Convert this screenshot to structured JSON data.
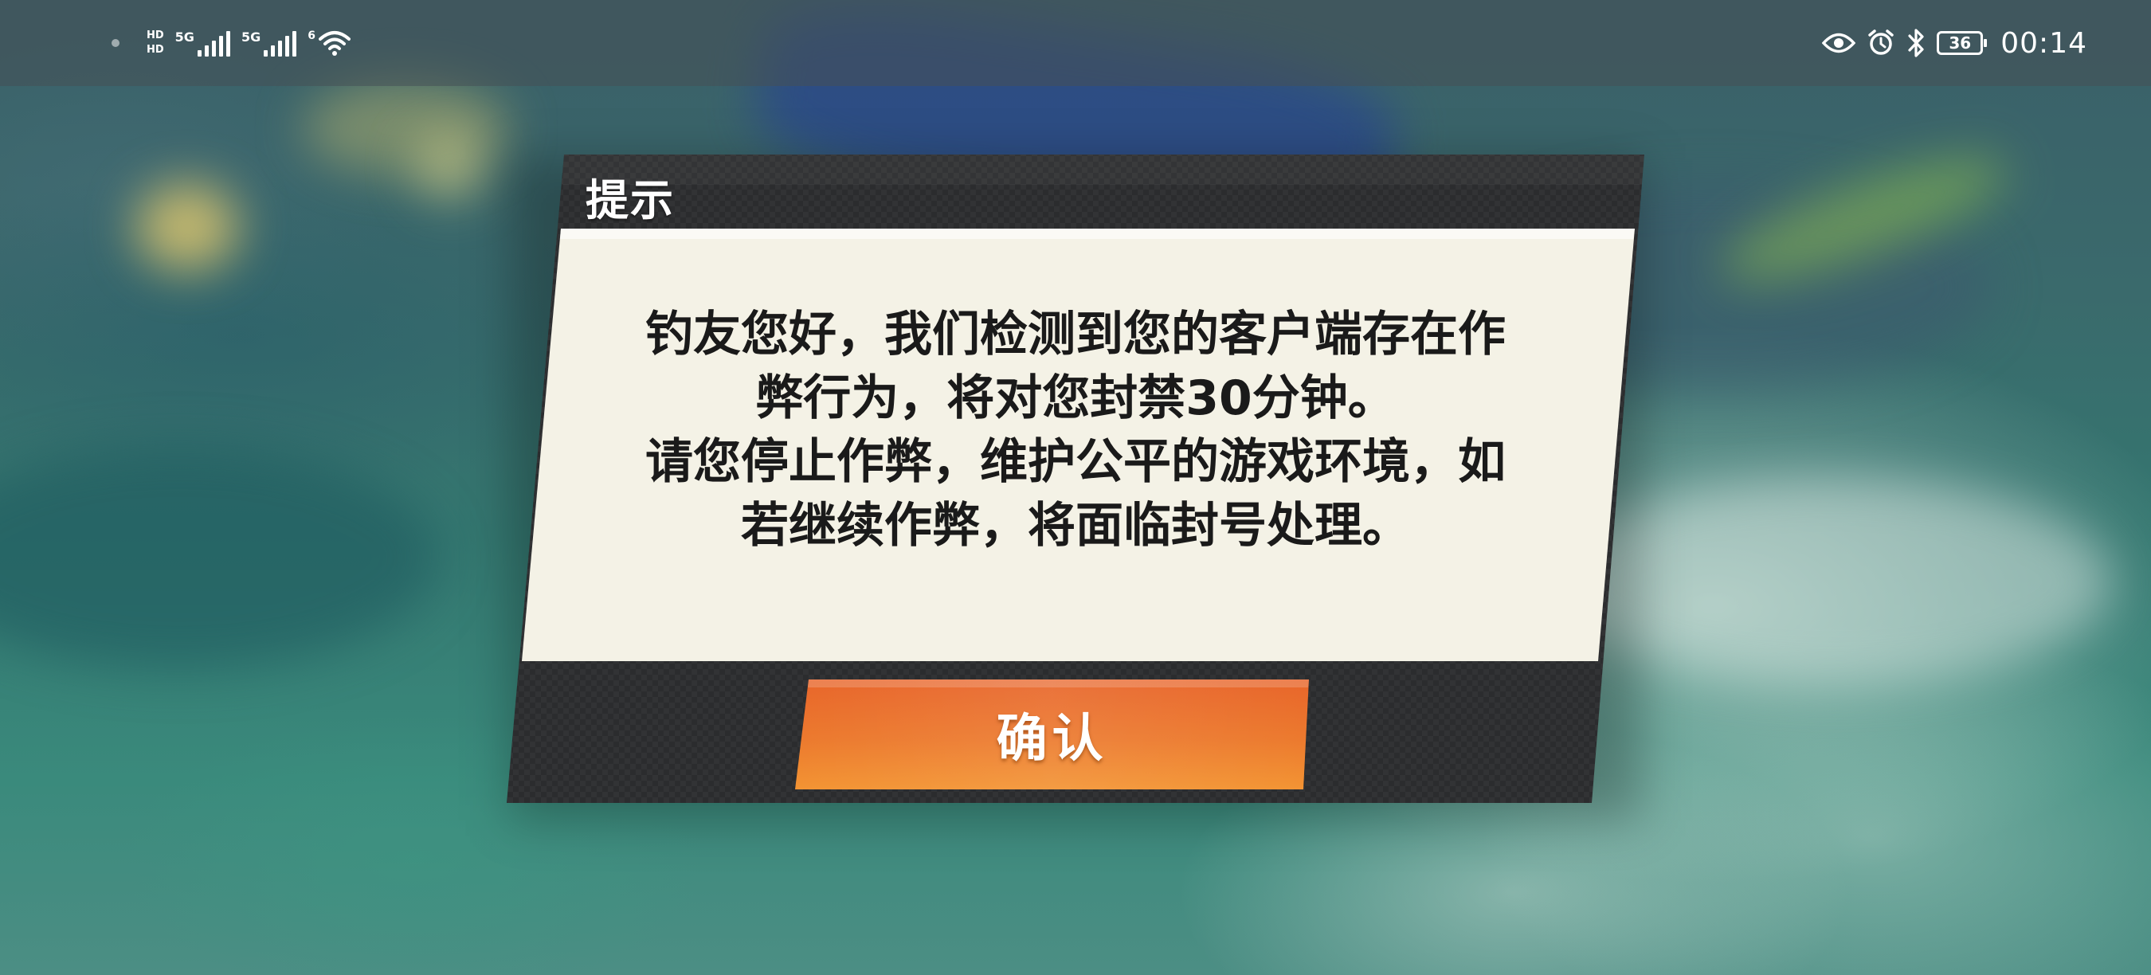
{
  "status_bar": {
    "left": {
      "hd_top": "HD",
      "hd_bottom": "HD",
      "sim1_network": "5G",
      "sim2_network": "5G",
      "wifi_label": "6"
    },
    "right": {
      "icons": [
        "eye-icon",
        "alarm-icon",
        "bluetooth-icon",
        "battery-icon"
      ],
      "battery_level": "36",
      "time": "00:14"
    }
  },
  "dialog": {
    "title": "提示",
    "message_lines": [
      "钓友您好，我们检测到您的客户端存在作",
      "弊行为，将对您封禁30分钟。",
      "请您停止作弊，维护公平的游戏环境，如",
      "若继续作弊，将面临封号处理。"
    ],
    "confirm_label": "确认"
  },
  "colors": {
    "dialog_frame": "#2a2b2d",
    "content_panel": "#f4f2e6",
    "button_orange_top": "#ea6a2a",
    "button_orange_bottom": "#f08a30",
    "text_dark": "#1a1a1a"
  }
}
